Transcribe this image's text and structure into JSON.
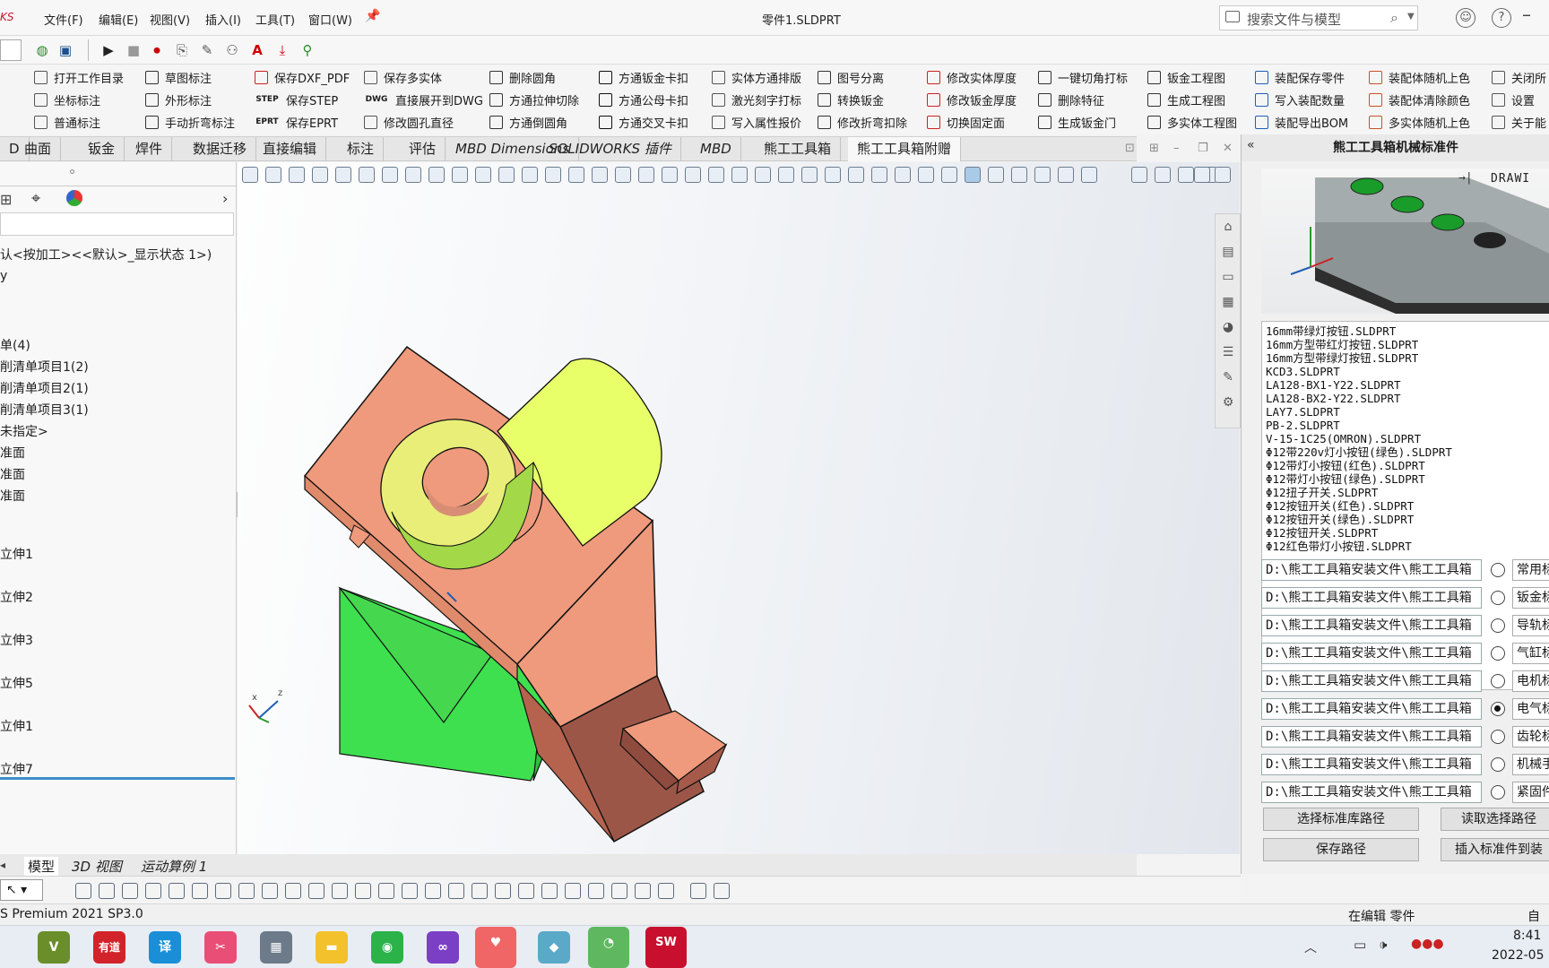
{
  "title_bar": {
    "app_logo_text": "KS",
    "menus": [
      "文件(F)",
      "编辑(E)",
      "视图(V)",
      "插入(I)",
      "工具(T)",
      "窗口(W)"
    ],
    "doc_title": "零件1.SLDPRT",
    "search_placeholder": "搜索文件与模型"
  },
  "command_rows": [
    [
      "打开工作目录",
      "草图标注",
      "保存DXF_PDF",
      "保存多实体",
      "删除圆角",
      "方通钣金卡扣",
      "实体方通排版",
      "图号分离",
      "修改实体厚度",
      "一键切角打标",
      "钣金工程图",
      "装配保存零件",
      "装配体随机上色",
      "关闭所"
    ],
    [
      "坐标标注",
      "外形标注",
      "保存STEP",
      "直接展开到DWG",
      "方通拉伸切除",
      "方通公母卡扣",
      "激光刻字打标",
      "转换钣金",
      "修改钣金厚度",
      "删除特征",
      "生成工程图",
      "写入装配数量",
      "装配体清除颜色",
      "设置"
    ],
    [
      "普通标注",
      "手动折弯标注",
      "保存EPRT",
      "修改圆孔直径",
      "方通倒圆角",
      "方通交叉卡扣",
      "写入属性报价",
      "修改折弯扣除",
      "切换固定面",
      "生成钣金门",
      "多实体工程图",
      "装配导出BOM",
      "多实体随机上色",
      "关于能"
    ]
  ],
  "command_badges": [
    "STEP",
    "DWG",
    "EPRT"
  ],
  "tabs": [
    "D",
    "曲面",
    "钣金",
    "焊件",
    "数据迁移",
    "直接编辑",
    "标注",
    "评估",
    "MBD Dimensions",
    "SOLIDWORKS 插件",
    "MBD",
    "熊工工具箱",
    "熊工工具箱附赠"
  ],
  "active_tab": "熊工工具箱附赠",
  "tree_items": [
    "认<按加工><<默认>_显示状态 1>)",
    "y",
    "单(4)",
    "削清单项目1(2)",
    "削清单项目2(1)",
    "削清单项目3(1)",
    "未指定>",
    "准面",
    "准面",
    "准面",
    "立伸1",
    "立伸2",
    "立伸3",
    "立伸5",
    "立伸1",
    "立伸7"
  ],
  "axis_labels": {
    "x": "x",
    "z": "z"
  },
  "panel": {
    "title": "熊工工具箱机械标准件",
    "preview_label": "DRAWI",
    "preview_arrow": "→|",
    "files": [
      "16mm带绿灯按钮.SLDPRT",
      "16mm方型带红灯按钮.SLDPRT",
      "16mm方型带绿灯按钮.SLDPRT",
      "KCD3.SLDPRT",
      "LA128-BX1-Y22.SLDPRT",
      "LA128-BX2-Y22.SLDPRT",
      "LAY7.SLDPRT",
      "PB-2.SLDPRT",
      "V-15-1C25(OMRON).SLDPRT",
      "Φ12带220v灯小按钮(绿色).SLDPRT",
      "Φ12带灯小按钮(红色).SLDPRT",
      "Φ12带灯小按钮(绿色).SLDPRT",
      "Φ12扭子开关.SLDPRT",
      "Φ12按钮开关(红色).SLDPRT",
      "Φ12按钮开关(绿色).SLDPRT",
      "Φ12按钮开关.SLDPRT",
      "Φ12红色带灯小按钮.SLDPRT"
    ],
    "path_value": "D:\\熊工工具箱安装文件\\熊工工具箱",
    "categories": [
      "常用标",
      "钣金标",
      "导轨标",
      "气缸标",
      "电机标",
      "电气标",
      "齿轮标",
      "机械手",
      "紧固件"
    ],
    "selected_category": "电气标",
    "buttons": {
      "select_path": "选择标准库路径",
      "read_path": "读取选择路径",
      "save_path": "保存路径",
      "insert_part": "插入标准件到装"
    }
  },
  "bottom_tabs": [
    "模型",
    "3D 视图",
    "运动算例 1"
  ],
  "status": {
    "app": "S Premium 2021 SP3.0",
    "mode": "在编辑 零件",
    "right": "自定"
  },
  "taskbar": {
    "time": "8:41",
    "date": "2022-05"
  },
  "colors": {
    "solid_salmon": "#ef9a7c",
    "solid_yellow": "#f2f58a",
    "solid_green": "#3fe04f",
    "accent_blue": "#1e5fb4"
  }
}
